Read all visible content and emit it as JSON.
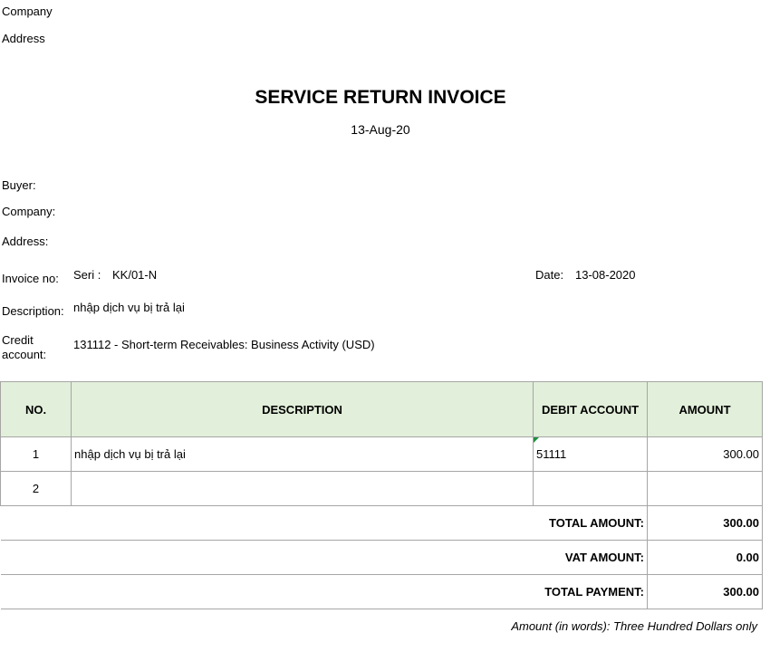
{
  "header": {
    "company_label": "Company",
    "address_label": "Address"
  },
  "title": "SERVICE RETURN INVOICE",
  "title_date": "13-Aug-20",
  "buyer": {
    "buyer_label": "Buyer:",
    "company_label": "Company:",
    "address_label": "Address:"
  },
  "invoice": {
    "no_label": "Invoice no:",
    "seri_label": "Seri :",
    "seri_value": "KK/01-N",
    "date_label": "Date:",
    "date_value": "13-08-2020",
    "description_label": "Description:",
    "description_value": "nhập dịch vụ bị trả lại",
    "credit_label": "Credit account:",
    "credit_value": "131112 - Short-term Receivables: Business Activity (USD)"
  },
  "table": {
    "headers": [
      "NO.",
      "DESCRIPTION",
      "DEBIT ACCOUNT",
      "AMOUNT"
    ],
    "rows": [
      {
        "no": "1",
        "description": "nhập dịch vụ bị trả lại",
        "account": "51111",
        "amount": "300.00"
      },
      {
        "no": "2",
        "description": "",
        "account": "",
        "amount": ""
      }
    ],
    "totals": [
      {
        "label": "TOTAL AMOUNT:",
        "value": "300.00"
      },
      {
        "label": "VAT AMOUNT:",
        "value": "0.00"
      },
      {
        "label": "TOTAL PAYMENT:",
        "value": "300.00"
      }
    ]
  },
  "amount_in_words": "Amount (in words): Three Hundred Dollars only",
  "colors": {
    "header_fill": "#e2efda",
    "grid": "#a6a6a6",
    "comment_marker": "#1e8e3e"
  }
}
